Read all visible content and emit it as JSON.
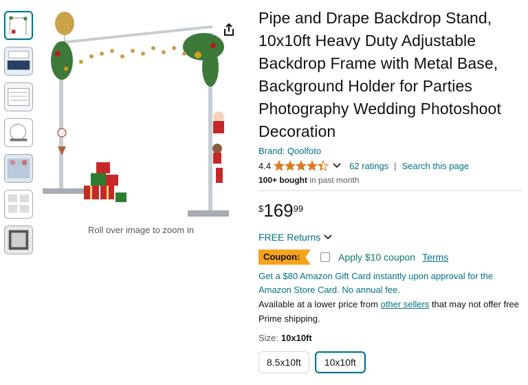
{
  "thumbnails": [
    {
      "name": "thumb-1",
      "active": true
    },
    {
      "name": "thumb-2",
      "active": false
    },
    {
      "name": "thumb-3",
      "active": false
    },
    {
      "name": "thumb-4",
      "active": false
    },
    {
      "name": "thumb-5",
      "active": false
    },
    {
      "name": "thumb-6",
      "active": false
    },
    {
      "name": "thumb-7",
      "active": false
    }
  ],
  "gallery": {
    "zoom_hint": "Roll over image to zoom in",
    "share_icon": "share-icon"
  },
  "product": {
    "title": "Pipe and Drape Backdrop Stand, 10x10ft Heavy Duty Adjustable Backdrop Frame with Metal Base, Background Holder for Parties Photography Wedding Photoshoot Decoration",
    "brand": "Brand: Qoolfoto",
    "rating_value": "4.4",
    "rating_stars": 4.4,
    "ratings_link": "62 ratings",
    "separator": "|",
    "search_link": "Search this page",
    "bought_bold": "100+ bought",
    "bought_rest": " in past month"
  },
  "price": {
    "symbol": "$",
    "whole": "169",
    "fraction": "99"
  },
  "returns": {
    "label": "FREE Returns"
  },
  "coupon": {
    "badge": "Coupon:",
    "text": "Apply $10 coupon",
    "terms": "Terms"
  },
  "promo": {
    "text": "Get a $80 Amazon Gift Card instantly upon approval for the Amazon Store Card. No annual fee."
  },
  "lower_price": {
    "prefix": "Available at a lower price from ",
    "link": "other sellers",
    "suffix": " that may not offer free Prime shipping."
  },
  "size": {
    "label": "Size:",
    "selected": "10x10ft",
    "options": [
      "8.5x10ft",
      "10x10ft"
    ]
  },
  "colors": {
    "link": "#007185",
    "coupon_green": "#067d62",
    "coupon_orange": "#f7a21b",
    "star": "#de7921"
  }
}
